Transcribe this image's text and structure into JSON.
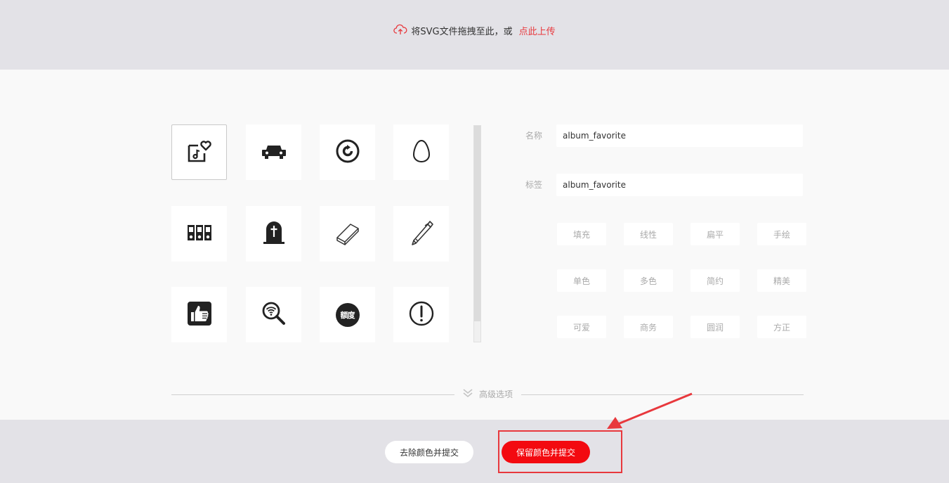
{
  "upload": {
    "prefix": "将SVG文件拖拽至此，或",
    "link": "点此上传",
    "icon": "cloud-upload-icon"
  },
  "icons": [
    {
      "name": "album-favorite-icon",
      "selected": true
    },
    {
      "name": "car-icon",
      "selected": false
    },
    {
      "name": "refresh-circle-icon",
      "selected": false
    },
    {
      "name": "egg-icon",
      "selected": false
    },
    {
      "name": "binders-icon",
      "selected": false
    },
    {
      "name": "tombstone-icon",
      "selected": false
    },
    {
      "name": "eraser-icon",
      "selected": false
    },
    {
      "name": "pen-icon",
      "selected": false
    },
    {
      "name": "thumbs-up-icon",
      "selected": false
    },
    {
      "name": "wifi-search-icon",
      "selected": false
    },
    {
      "name": "quota-badge-icon",
      "selected": false,
      "text": "额度"
    },
    {
      "name": "exclamation-circle-icon",
      "selected": false
    }
  ],
  "form": {
    "name_label": "名称",
    "name_value": "album_favorite",
    "tags_label": "标签",
    "tags_value": "album_favorite"
  },
  "tags": [
    "填充",
    "线性",
    "扁平",
    "手绘",
    "单色",
    "多色",
    "简约",
    "精美",
    "可爱",
    "商务",
    "圆润",
    "方正"
  ],
  "advanced": {
    "label": "高级选项",
    "icon": "double-chevron-down-icon"
  },
  "buttons": {
    "strip_color": "去除颜色并提交",
    "keep_color": "保留颜色并提交"
  },
  "colors": {
    "accent": "#f30a10",
    "link": "#e8383d",
    "band": "#e3e2e7",
    "panel": "#f9f9f9"
  }
}
